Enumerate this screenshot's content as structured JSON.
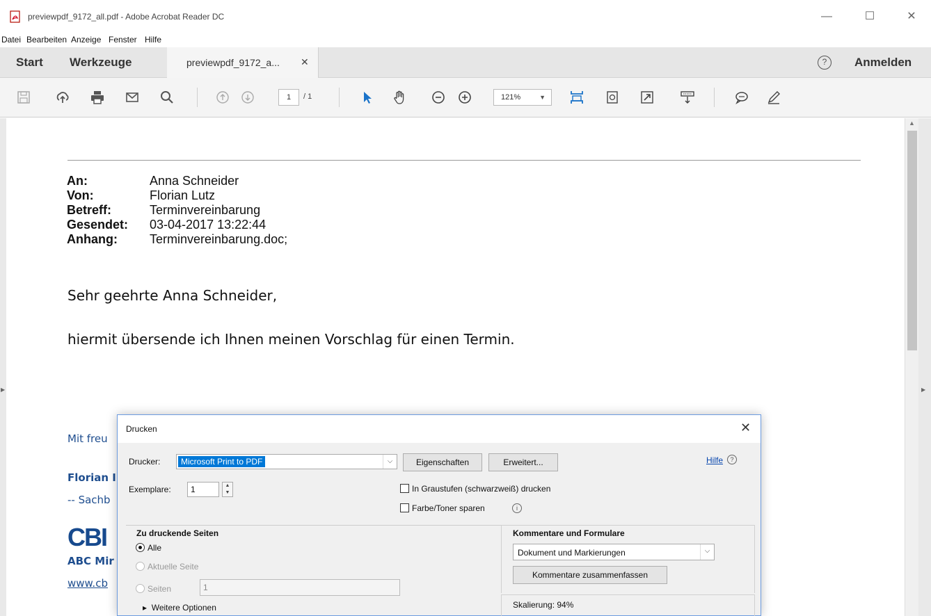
{
  "window": {
    "title": "previewpdf_9172_all.pdf - Adobe Acrobat Reader DC",
    "controls": {
      "minimize": "—",
      "maximize": "☐",
      "close": "✕"
    }
  },
  "menu": [
    "Datei",
    "Bearbeiten",
    "Anzeige",
    "Fenster",
    "Hilfe"
  ],
  "tabs": {
    "start": "Start",
    "tools": "Werkzeuge",
    "document": "previewpdf_9172_a...",
    "close_glyph": "✕",
    "help_glyph": "?",
    "signin": "Anmelden"
  },
  "toolbar": {
    "page_current": "1",
    "page_total": "/ 1",
    "zoom": "121%",
    "icons": [
      "save-icon",
      "upload-icon",
      "print-icon",
      "mail-icon",
      "search-icon",
      "page-up-icon",
      "page-down-icon",
      "select-arrow-icon",
      "hand-icon",
      "zoom-out-icon",
      "zoom-in-icon",
      "fit-page-icon",
      "rotate-icon",
      "fullscreen-icon",
      "read-mode-icon",
      "comment-icon",
      "pen-icon"
    ]
  },
  "email": {
    "fields": [
      {
        "key": "An:",
        "value": "Anna Schneider"
      },
      {
        "key": "Von:",
        "value": "Florian Lutz"
      },
      {
        "key": "Betreff:",
        "value": "Terminvereinbarung"
      },
      {
        "key": "Gesendet:",
        "value": "03-04-2017 13:22:44"
      },
      {
        "key": "Anhang:",
        "value": "Terminvereinbarung.doc;"
      }
    ],
    "greeting": "Sehr geehrte Anna Schneider,",
    "body": "hiermit übersende ich Ihnen meinen Vorschlag für einen Termin.",
    "closing_partial": "Mit freu",
    "name_partial": "Florian I",
    "role_partial": "-- Sachb",
    "logo_partial": "CBI",
    "company_partial": "ABC Mir",
    "url_partial": "www.cb"
  },
  "dialog": {
    "title": "Drucken",
    "close_glyph": "✕",
    "printer_label": "Drucker:",
    "printer_value": "Microsoft Print to PDF",
    "properties_button": "Eigenschaften",
    "advanced_button": "Erweitert...",
    "help_link": "Hilfe",
    "copies_label": "Exemplare:",
    "copies_value": "1",
    "grayscale_label": "In Graustufen (schwarzweiß) drucken",
    "save_toner_label": "Farbe/Toner sparen",
    "pages_group": {
      "title": "Zu druckende Seiten",
      "all": "Alle",
      "current": "Aktuelle Seite",
      "pages": "Seiten",
      "pages_value": "1",
      "more_options": "Weitere Optionen"
    },
    "comments_group": {
      "title": "Kommentare und Formulare",
      "select_value": "Dokument und Markierungen",
      "summarize_button": "Kommentare zusammenfassen"
    },
    "scaling": "Skalierung:  94%"
  }
}
